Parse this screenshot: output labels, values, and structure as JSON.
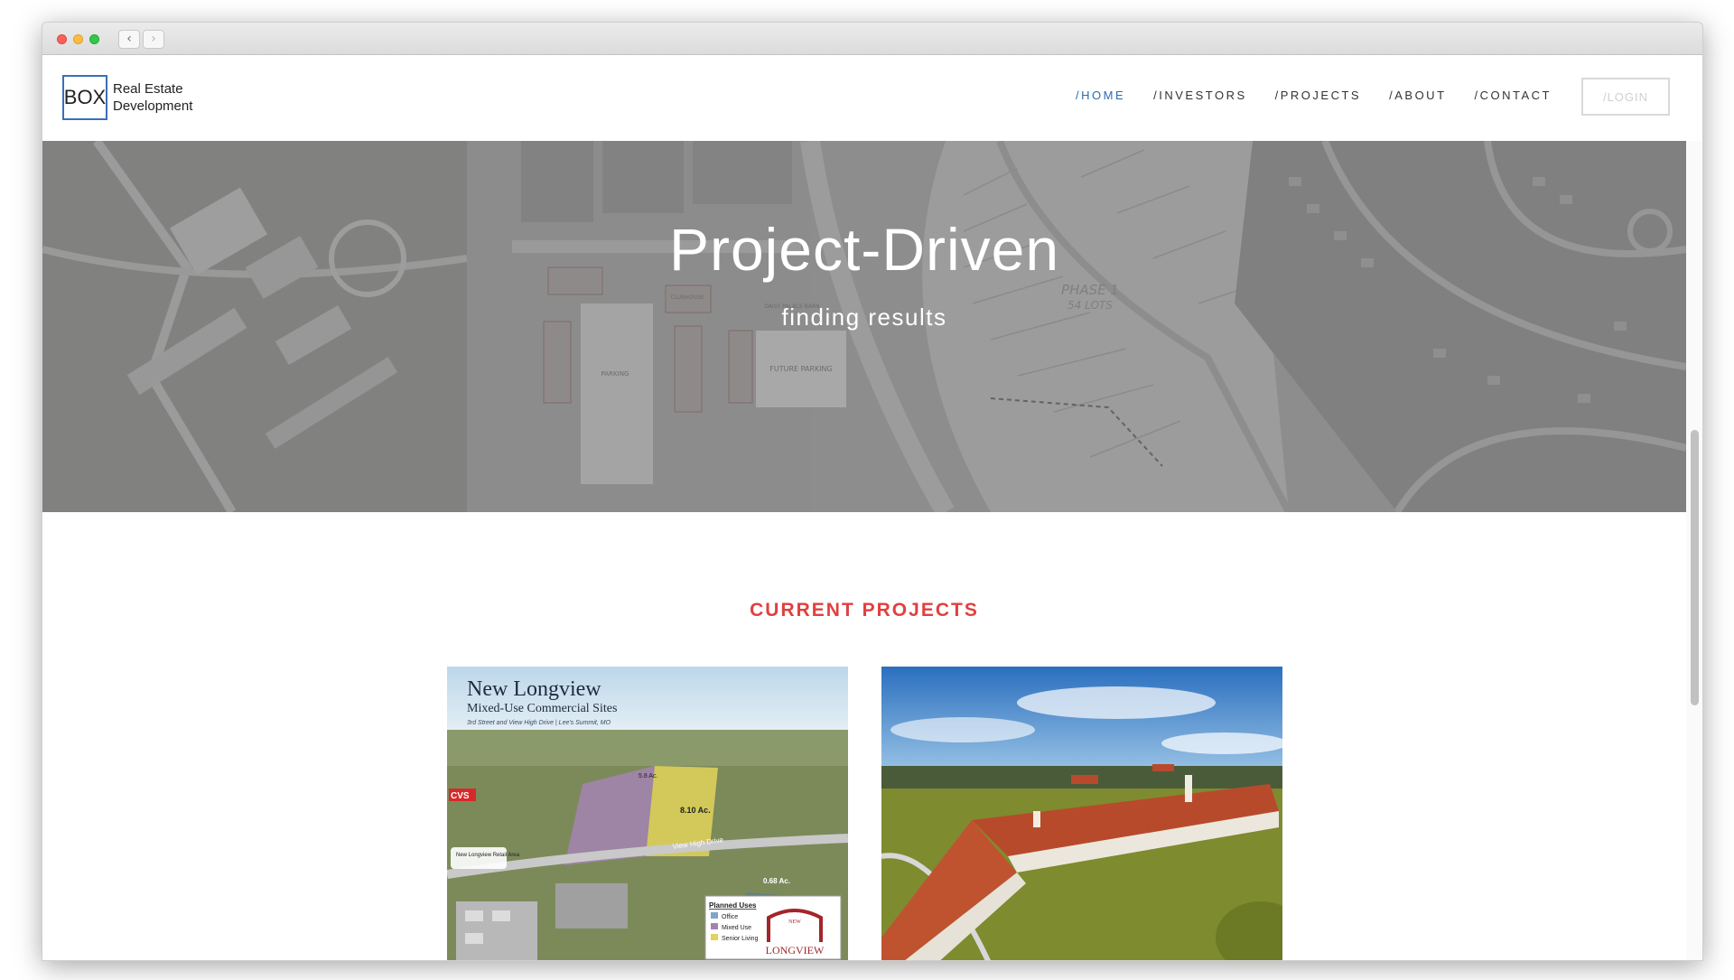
{
  "browser": {
    "back_icon": "‹",
    "forward_icon": "›"
  },
  "logo": {
    "box_text": "BOX",
    "line1": "Real Estate",
    "line2": "Development"
  },
  "nav": {
    "items": [
      {
        "label": "/HOME",
        "active": true
      },
      {
        "label": "/INVESTORS",
        "active": false
      },
      {
        "label": "/PROJECTS",
        "active": false
      },
      {
        "label": "/ABOUT",
        "active": false
      },
      {
        "label": "/CONTACT",
        "active": false
      }
    ],
    "login_label": "/LOGIN"
  },
  "hero": {
    "title": "Project-Driven",
    "subtitle": "finding results",
    "map_labels": {
      "phase": "PHASE 1",
      "lots": "54 LOTS",
      "parking": "PARKING",
      "future_parking": "FUTURE PARKING",
      "clubhouse": "CLUBHOUSE",
      "daisy": "DAISY PALACE BARN"
    }
  },
  "projects": {
    "heading": "CURRENT PROJECTS",
    "cards": [
      {
        "title": "New Longview",
        "subtitle": "Mixed-Use Commercial Sites",
        "address": "3rd Street and View High Drive | Lee's Summit, MO",
        "acres": [
          "8.10 Ac.",
          "5.8 Ac.",
          "0.68 Ac."
        ],
        "retail_label": "New Longview Retail Area",
        "street": "View High Drive",
        "legend_title": "Planned Uses",
        "legend": [
          "Office",
          "Mixed Use",
          "Senior Living"
        ],
        "brand": "LONGVIEW",
        "brand_top": "NEW"
      },
      {
        "title": "Longview Barn aerial"
      }
    ]
  },
  "colors": {
    "accent_red": "#e0403f",
    "nav_active": "#2b6cb0",
    "logo_border": "#3a6fb7"
  }
}
